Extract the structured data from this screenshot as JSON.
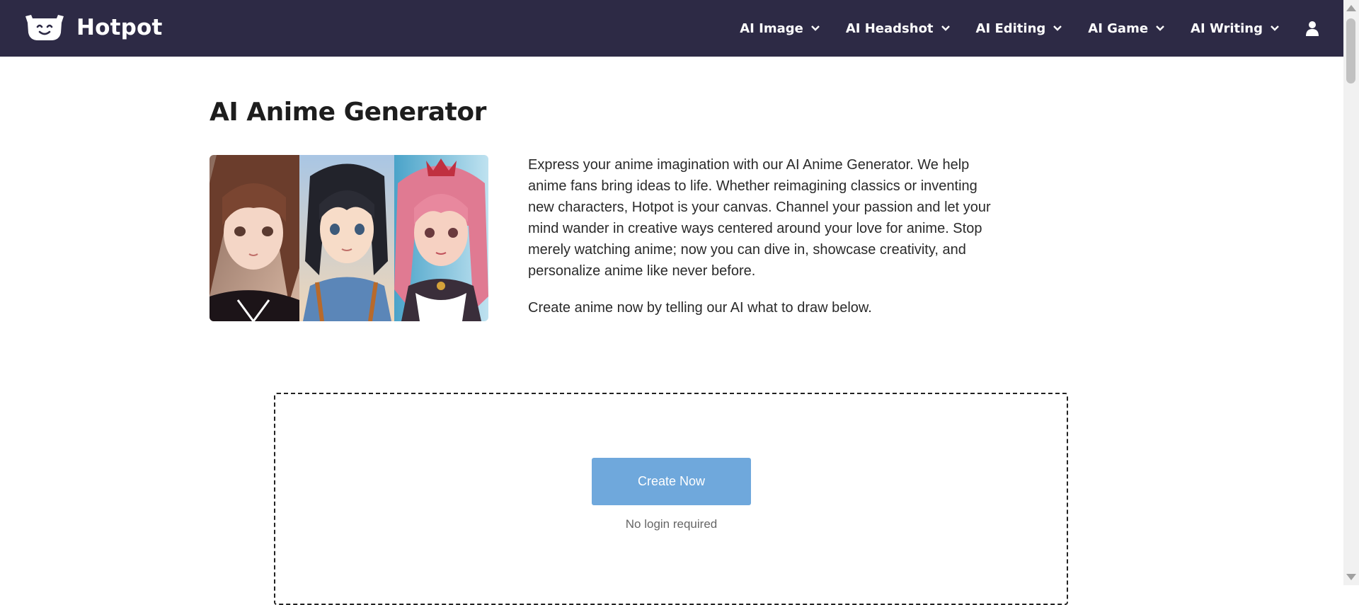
{
  "header": {
    "brand": "Hotpot",
    "nav": [
      {
        "label": "AI Image"
      },
      {
        "label": "AI Headshot"
      },
      {
        "label": "AI Editing"
      },
      {
        "label": "AI Game"
      },
      {
        "label": "AI Writing"
      }
    ],
    "icons": {
      "logo": "hotpot-face-logo",
      "chevron": "chevron-down-icon",
      "user": "user-icon"
    }
  },
  "main": {
    "title": "AI Anime Generator",
    "image": {
      "subject": "three anime character portraits"
    },
    "intro": "Express your anime imagination with our AI Anime Generator. We help anime fans bring ideas to life. Whether reimagining classics or inventing new characters, Hotpot is your canvas. Channel your passion and let your mind wander in creative ways centered around your love for anime. Stop merely watching anime; now you can dive in, showcase creativity, and personalize anime like never before.",
    "cta_text": "Create anime now by telling our AI what to draw below.",
    "create_button": "Create Now",
    "no_login": "No login required"
  },
  "colors": {
    "header_bg": "#2d2a45",
    "button_bg": "#6fa8dc",
    "text": "#2a2a2a"
  }
}
